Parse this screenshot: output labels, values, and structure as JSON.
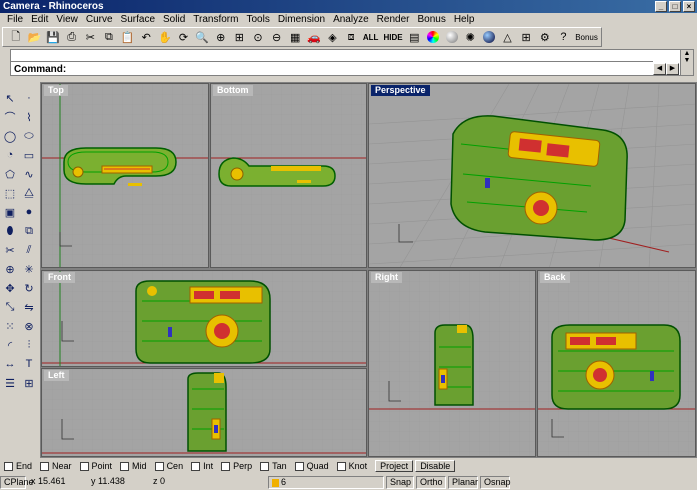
{
  "window": {
    "title": "Camera - Rhinoceros"
  },
  "menu": [
    "File",
    "Edit",
    "View",
    "Curve",
    "Surface",
    "Solid",
    "Transform",
    "Tools",
    "Dimension",
    "Analyze",
    "Render",
    "Bonus",
    "Help"
  ],
  "toolbar": {
    "icons": [
      "new-icon",
      "open-icon",
      "save-icon",
      "print-icon",
      "cut-icon",
      "copy-icon",
      "paste-icon",
      "undo-icon",
      "pan-icon",
      "rotate-view-icon",
      "zoom-window-icon",
      "zoom-dynamic-icon",
      "zoom-extents-icon",
      "zoom-selected-icon",
      "four-viewports-icon",
      "car-icon",
      "render-icon"
    ],
    "all_label": "ALL",
    "hide_label": "HIDE",
    "bonus_label": "Bonus"
  },
  "command": {
    "label": "Command:",
    "value": ""
  },
  "viewports": {
    "top": "Top",
    "bottom": "Bottom",
    "perspective": "Perspective",
    "front": "Front",
    "right": "Right",
    "back": "Back",
    "left": "Left"
  },
  "osnap": {
    "items": [
      "End",
      "Near",
      "Point",
      "Mid",
      "Cen",
      "Int",
      "Perp",
      "Tan",
      "Quad",
      "Knot"
    ],
    "project_label": "Project",
    "disable_label": "Disable"
  },
  "status": {
    "cplane": "CPlane",
    "x": "x 15.461",
    "y": "y 11.438",
    "z": "z 0",
    "layer": "6",
    "snap": "Snap",
    "ortho": "Ortho",
    "planar": "Planar",
    "osnap": "Osnap"
  },
  "colors": {
    "wire": "#00a000",
    "highlight": "#f0d000",
    "accent": "#e03030",
    "viewport_bg": "#a4a4a4"
  }
}
